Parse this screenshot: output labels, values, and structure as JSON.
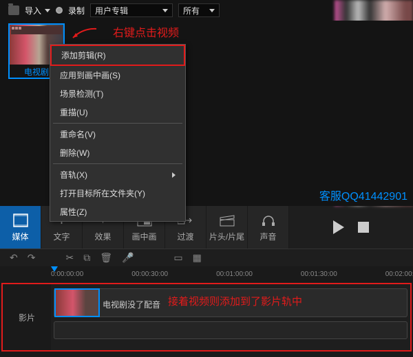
{
  "toolbar": {
    "import": "导入",
    "record": "录制",
    "album": "用户专辑",
    "filter": "所有"
  },
  "thumb": {
    "label": "电视剧"
  },
  "annotation": {
    "rightclick": "右键点击视频",
    "added": "接着视频则添加到了影片轨中",
    "qq": "客服QQ41442901"
  },
  "menu": {
    "add_clip": "添加剪辑(R)",
    "apply_pip": "应用到画中画(S)",
    "scene_detect": "场景检测(T)",
    "repeat": "重描(U)",
    "rename": "重命名(V)",
    "delete": "删除(W)",
    "audio": "音轨(X)",
    "open_folder": "打开目标所在文件夹(Y)",
    "properties": "属性(Z)"
  },
  "tabs": {
    "media": "媒体",
    "text": "文字",
    "effect": "效果",
    "pip": "画中画",
    "transition": "过渡",
    "titles": "片头/片尾",
    "sound": "声音"
  },
  "ruler": {
    "t0": "0:00:00:00",
    "t1": "00:00:30:00",
    "t2": "00:01:00:00",
    "t3": "00:01:30:00",
    "t4": "00:02:00:00"
  },
  "track": {
    "label": "影片",
    "clip_title": "电视剧没了配音"
  }
}
